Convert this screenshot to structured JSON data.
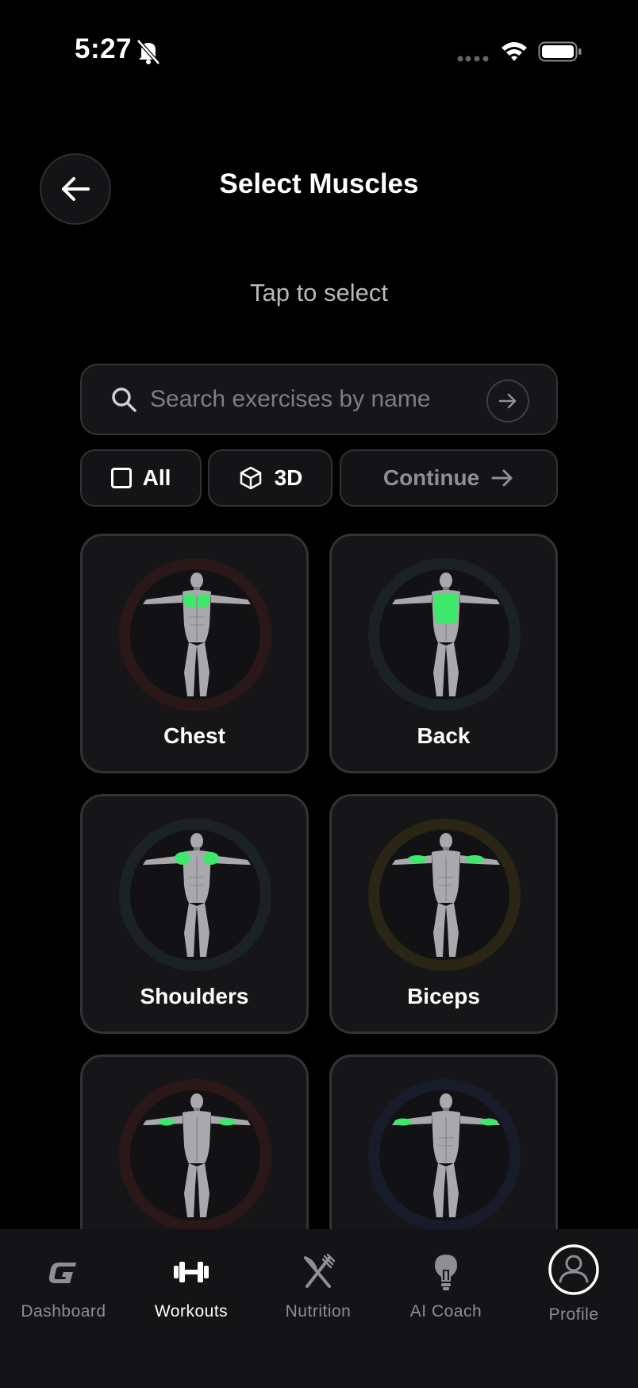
{
  "status_bar": {
    "time": "5:27"
  },
  "header": {
    "title": "Select Muscles",
    "subtitle": "Tap to select"
  },
  "search": {
    "placeholder": "Search exercises by name"
  },
  "filters": {
    "all_label": "All",
    "three_d_label": "3D",
    "continue_label": "Continue"
  },
  "muscles": [
    {
      "label": "Chest",
      "ring_color": "#2a1818",
      "highlight": "chest",
      "view": "front"
    },
    {
      "label": "Back",
      "ring_color": "#1a2222",
      "highlight": "back",
      "view": "back"
    },
    {
      "label": "Shoulders",
      "ring_color": "#1a2222",
      "highlight": "shoulders",
      "view": "front"
    },
    {
      "label": "Biceps",
      "ring_color": "#2a2514",
      "highlight": "biceps",
      "view": "front"
    },
    {
      "label": "",
      "ring_color": "#2a1818",
      "highlight": "triceps",
      "view": "back"
    },
    {
      "label": "",
      "ring_color": "#181c2a",
      "highlight": "forearms",
      "view": "front"
    }
  ],
  "colors": {
    "highlight": "#3ee86a",
    "background": "#000000",
    "card": "#161618",
    "accent_text": "#ffffff"
  },
  "bottom_nav": [
    {
      "label": "Dashboard",
      "icon": "logo-g-icon",
      "active": false
    },
    {
      "label": "Workouts",
      "icon": "dumbbell-icon",
      "active": true
    },
    {
      "label": "Nutrition",
      "icon": "fork-knife-icon",
      "active": false
    },
    {
      "label": "AI Coach",
      "icon": "lightbulb-icon",
      "active": false
    },
    {
      "label": "Profile",
      "icon": "profile-icon",
      "active": false
    }
  ]
}
